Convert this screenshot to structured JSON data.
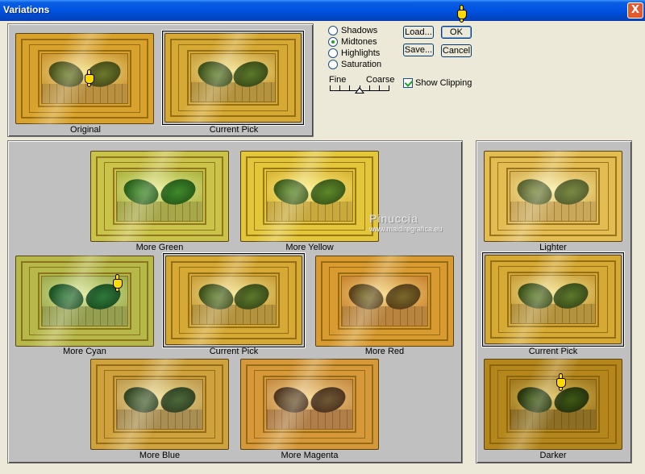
{
  "window": {
    "title": "Variations",
    "close_symbol": "X"
  },
  "original_panel": {
    "original_caption": "Original",
    "current_pick_caption": "Current Pick"
  },
  "options": {
    "radios": [
      {
        "label": "Shadows",
        "selected": false
      },
      {
        "label": "Midtones",
        "selected": true
      },
      {
        "label": "Highlights",
        "selected": false
      },
      {
        "label": "Saturation",
        "selected": false
      }
    ],
    "slider": {
      "fine_label": "Fine",
      "coarse_label": "Coarse"
    },
    "show_clipping": {
      "label": "Show Clipping",
      "checked": true
    }
  },
  "buttons": {
    "load": "Load...",
    "ok": "OK",
    "save": "Save...",
    "cancel": "Cancel"
  },
  "color_grid": {
    "more_green": "More Green",
    "more_yellow": "More Yellow",
    "more_cyan": "More Cyan",
    "current_pick": "Current Pick",
    "more_red": "More Red",
    "more_blue": "More Blue",
    "more_magenta": "More Magenta"
  },
  "brightness": {
    "lighter": "Lighter",
    "current_pick": "Current Pick",
    "darker": "Darker"
  },
  "watermark": {
    "name": "Pinuccia",
    "url": "www.maidiregrafica.eu"
  },
  "colors": {
    "titlebar": "#0054e3",
    "panel": "#c0c0c0",
    "dialog": "#ece9d8",
    "pointer": "#ffd900"
  }
}
